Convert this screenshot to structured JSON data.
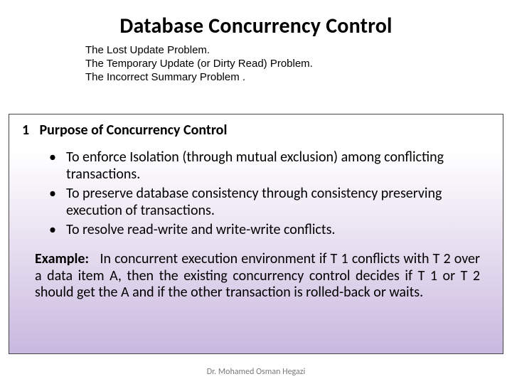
{
  "title": "Database Concurrency Control",
  "subpoints": [
    "The Lost Update Problem.",
    "The Temporary Update (or Dirty Read) Problem.",
    "The Incorrect Summary Problem ."
  ],
  "section": {
    "number": "1",
    "heading": "Purpose of Concurrency Control",
    "bullets": [
      "To enforce Isolation (through mutual exclusion) among conflicting transactions.",
      "To preserve database consistency through consistency preserving execution of transactions.",
      "To resolve read-write and write-write conflicts."
    ],
    "example_label": "Example:",
    "example_text": "In concurrent execution environment if T 1 conflicts with T 2 over a data item A, then the existing concurrency control decides if T 1 or T 2 should get the A and if the other transaction is rolled-back or waits."
  },
  "footer": "Dr. Mohamed Osman Hegazi"
}
